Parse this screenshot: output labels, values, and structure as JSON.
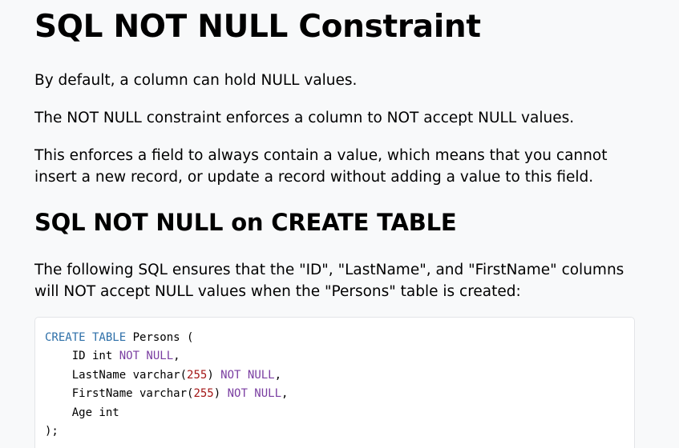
{
  "heading": "SQL NOT NULL Constraint",
  "paragraphs": [
    "By default, a column can hold NULL values.",
    "The NOT NULL constraint enforces a column to NOT accept NULL values.",
    "This enforces a field to always contain a value, which means that you cannot insert a new record, or update a record without adding a value to this field."
  ],
  "subheading": "SQL NOT NULL on CREATE TABLE",
  "example_intro": "The following SQL ensures that the \"ID\", \"LastName\", and \"FirstName\" columns will NOT accept NULL values when the \"Persons\" table is created:",
  "code": {
    "line1": {
      "kw": "CREATE TABLE",
      "rest": " Persons ("
    },
    "line2": {
      "pre": "    ID int ",
      "kw": "NOT NULL",
      "post": ","
    },
    "line3": {
      "pre": "    LastName varchar(",
      "num": "255",
      "mid": ") ",
      "kw": "NOT NULL",
      "post": ","
    },
    "line4": {
      "pre": "    FirstName varchar(",
      "num": "255",
      "mid": ") ",
      "kw": "NOT NULL",
      "post": ","
    },
    "line5": {
      "text": "    Age int"
    },
    "line6": {
      "text": ");"
    }
  }
}
